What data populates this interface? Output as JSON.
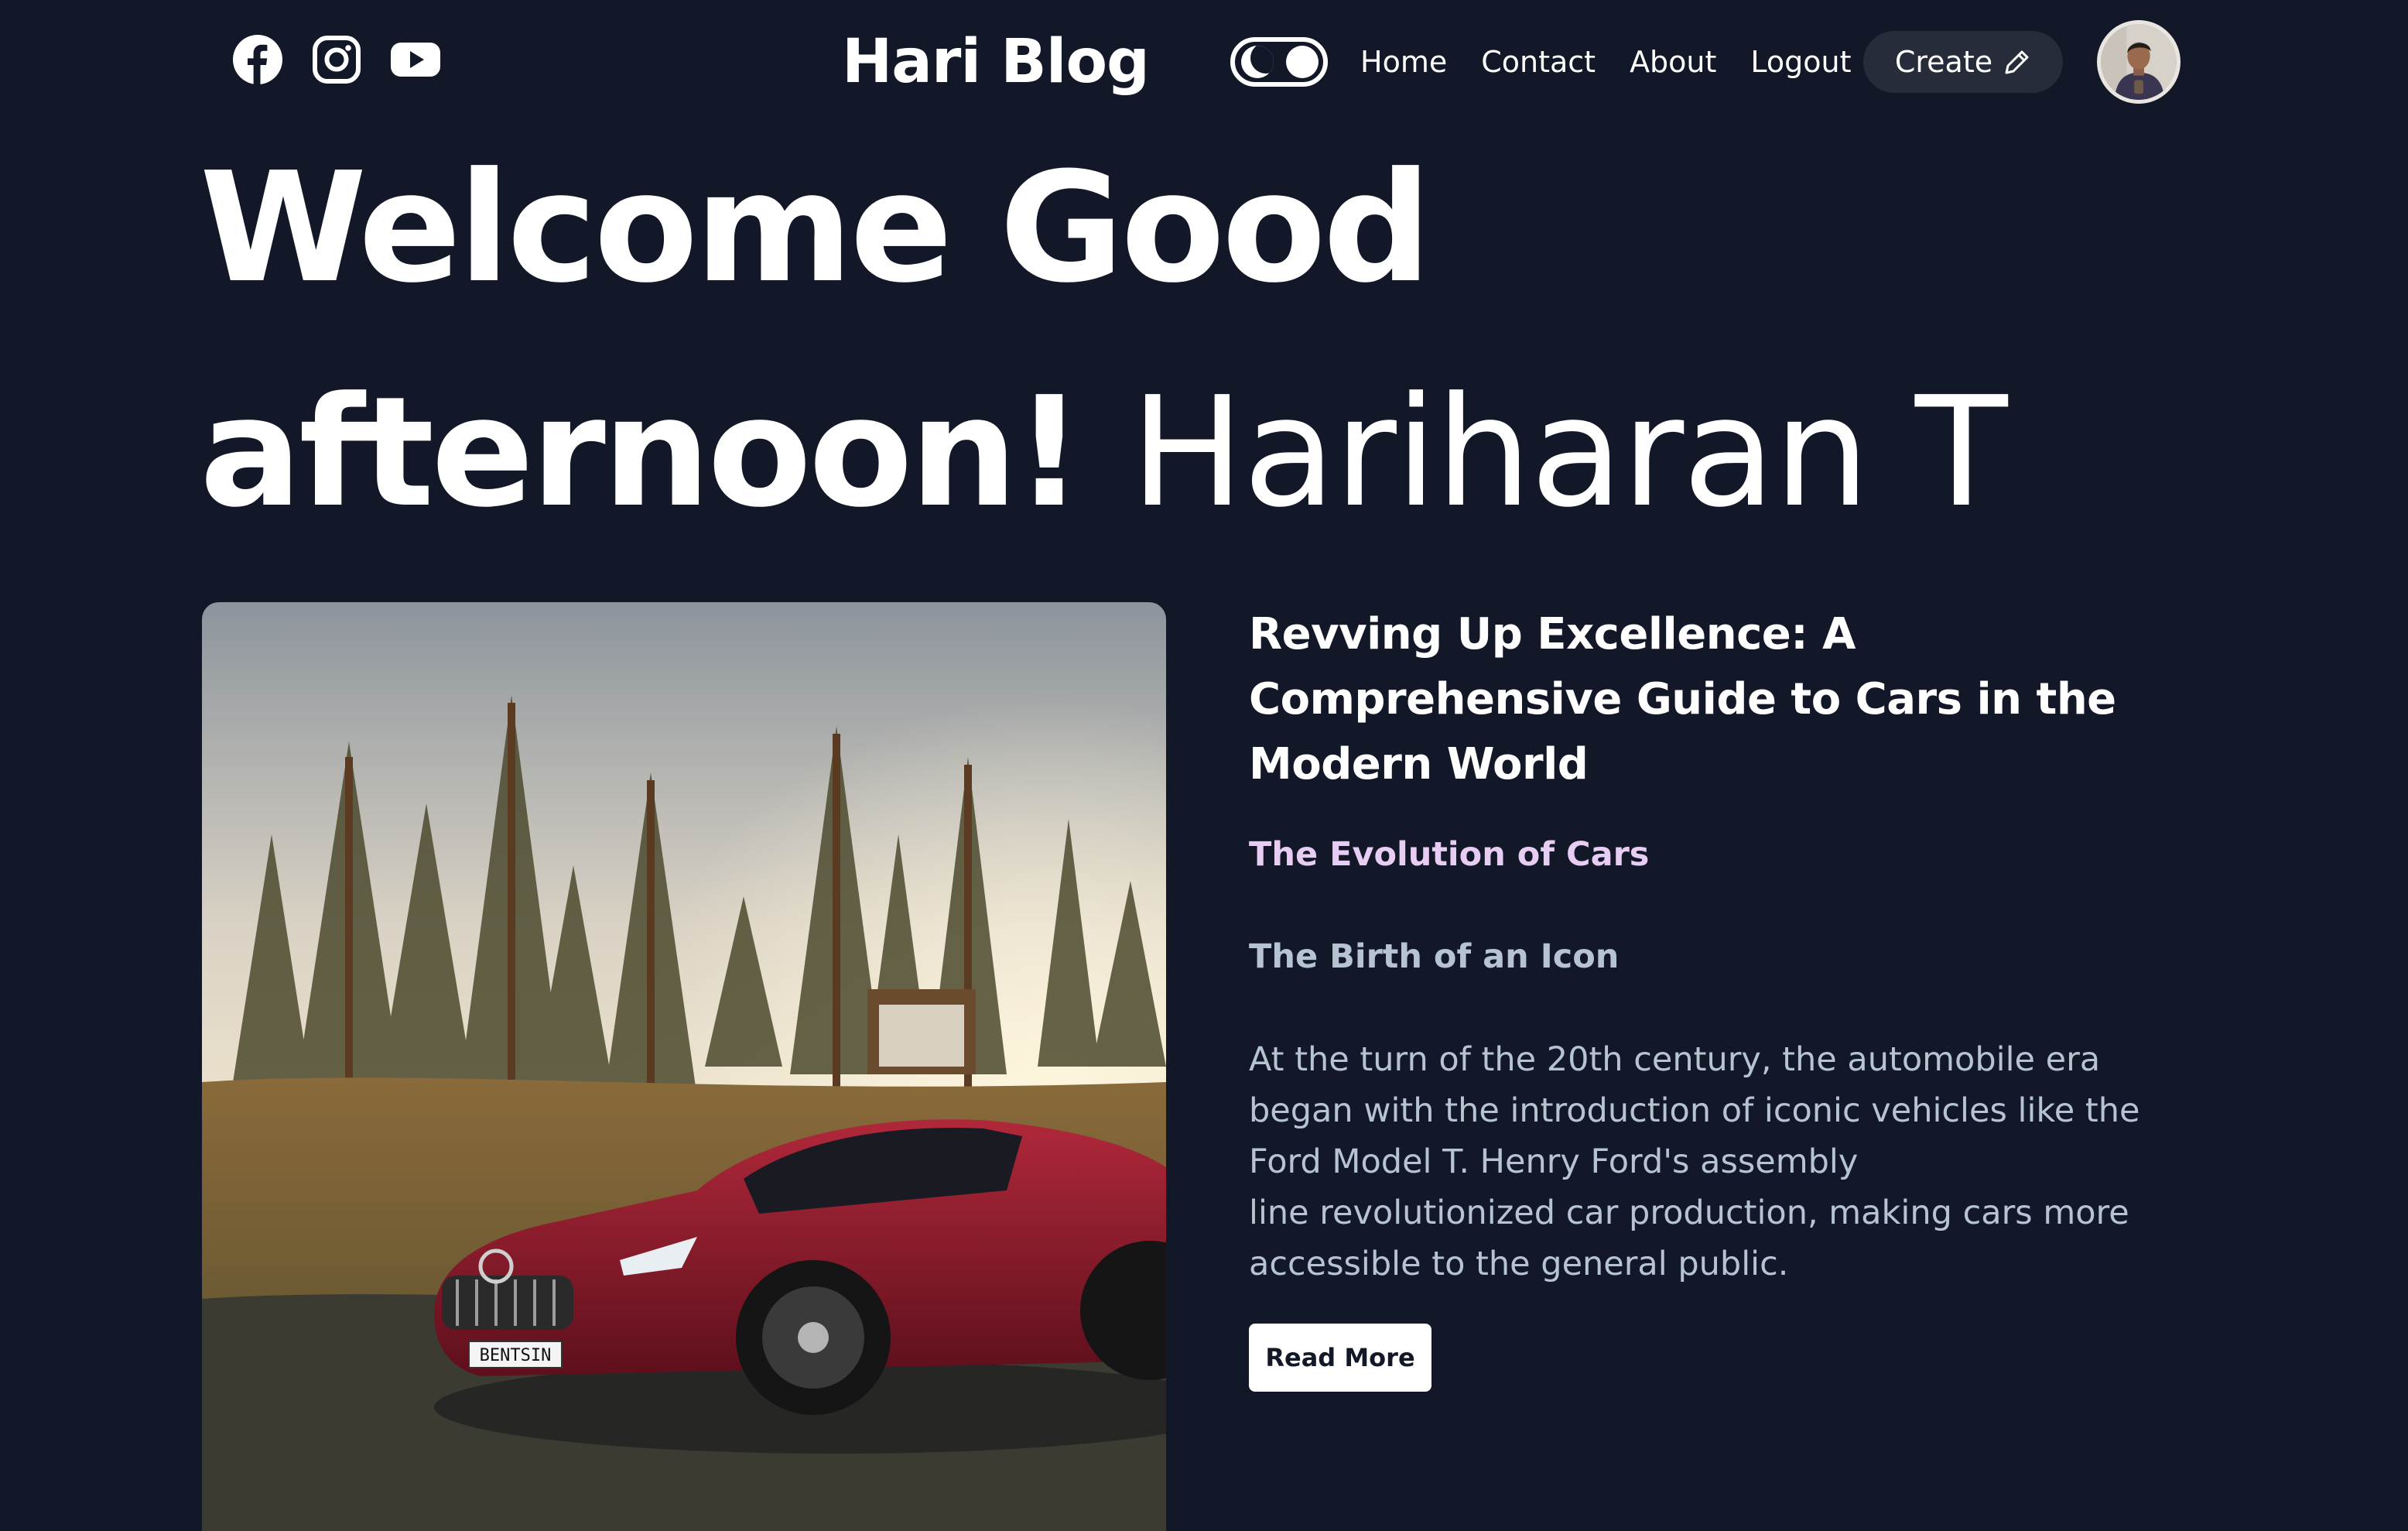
{
  "header": {
    "socials": [
      {
        "icon": "facebook-icon"
      },
      {
        "icon": "instagram-icon"
      },
      {
        "icon": "youtube-icon"
      }
    ],
    "brand": "Hari Blog",
    "nav": {
      "home": "Home",
      "contact": "Contact",
      "about": "About",
      "logout": "Logout"
    },
    "create_label": "Create",
    "create_icon": "pencil-icon"
  },
  "hero": {
    "greeting_line1": "Welcome Good",
    "greeting_line2": "afternoon!",
    "user_name": "Hariharan T"
  },
  "post": {
    "title": "Revving Up Excellence: A Comprehensive Guide to Cars in the Modern World",
    "heading_1": "The Evolution of Cars",
    "heading_2": "The Birth of an Icon",
    "paragraph_lines": [
      "At the turn of the 20th century, the automobile era",
      "began with the introduction of iconic vehicles like the",
      "Ford Model T. Henry Ford's assembly",
      "line revolutionized car production, making cars more",
      "accessible to the general public."
    ],
    "read_more_label": "Read More",
    "license_plate": "BENTSIN"
  },
  "colors": {
    "background": "#131828",
    "text": "#ffffff",
    "accent_heading": "#e7cdf3",
    "muted_text": "#b6c4d1",
    "create_button_bg": "#272c3a"
  }
}
